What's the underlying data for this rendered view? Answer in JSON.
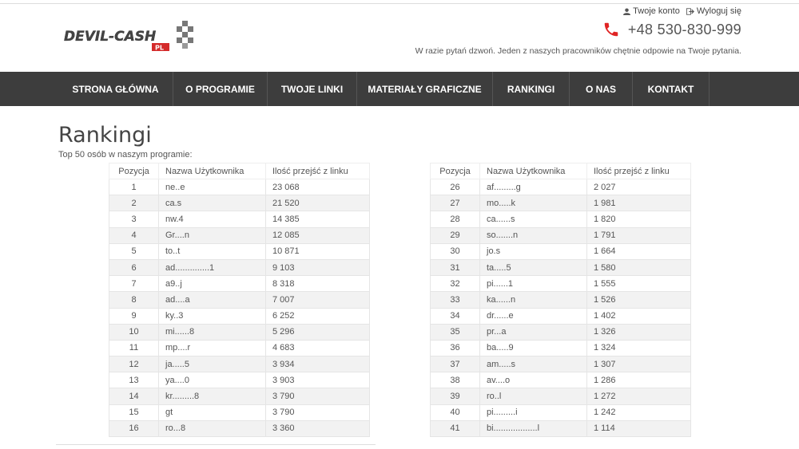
{
  "header": {
    "logo_text": "DEVIL-CASH",
    "logo_suffix": "PL",
    "account_label": "Twoje konto",
    "logout_label": "Wyloguj się",
    "phone": "+48 530-830-999",
    "tagline": "W razie pytań dzwoń. Jeden z naszych pracowników chętnie odpowie na Twoje pytania."
  },
  "nav": {
    "items": [
      {
        "label": "STRONA GŁÓWNA"
      },
      {
        "label": "O PROGRAMIE"
      },
      {
        "label": "TWOJE LINKI"
      },
      {
        "label": "MATERIAŁY GRAFICZNE"
      },
      {
        "label": "RANKINGI"
      },
      {
        "label": "O NAS"
      },
      {
        "label": "KONTAKT"
      }
    ]
  },
  "page": {
    "title": "Rankingi",
    "subtitle": "Top 50 osób w naszym programie:"
  },
  "table": {
    "headers": [
      "Pozycja",
      "Nazwa Użytkownika",
      "Ilość przejść z linku"
    ],
    "left_rows": [
      [
        "1",
        "ne..e",
        "23 068"
      ],
      [
        "2",
        "ca.s",
        "21 520"
      ],
      [
        "3",
        "nw.4",
        "14 385"
      ],
      [
        "4",
        "Gr....n",
        "12 085"
      ],
      [
        "5",
        "to..t",
        "10 871"
      ],
      [
        "6",
        "ad..............1",
        "9 103"
      ],
      [
        "7",
        "a9..j",
        "8 318"
      ],
      [
        "8",
        "ad....a",
        "7 007"
      ],
      [
        "9",
        "ky..3",
        "6 252"
      ],
      [
        "10",
        "mi......8",
        "5 296"
      ],
      [
        "11",
        "mp....r",
        "4 683"
      ],
      [
        "12",
        "ja.....5",
        "3 934"
      ],
      [
        "13",
        "ya....0",
        "3 903"
      ],
      [
        "14",
        "kr.........8",
        "3 790"
      ],
      [
        "15",
        "gt",
        "3 790"
      ],
      [
        "16",
        "ro...8",
        "3 360"
      ]
    ],
    "right_rows": [
      [
        "26",
        "af.........g",
        "2 027"
      ],
      [
        "27",
        "mo.....k",
        "1 981"
      ],
      [
        "28",
        "ca......s",
        "1 820"
      ],
      [
        "29",
        "so.......n",
        "1 791"
      ],
      [
        "30",
        "jo.s",
        "1 664"
      ],
      [
        "31",
        "ta.....5",
        "1 580"
      ],
      [
        "32",
        "pi......1",
        "1 555"
      ],
      [
        "33",
        "ka......n",
        "1 526"
      ],
      [
        "34",
        "dr......e",
        "1 402"
      ],
      [
        "35",
        "pr...a",
        "1 326"
      ],
      [
        "36",
        "ba.....9",
        "1 324"
      ],
      [
        "37",
        "am.....s",
        "1 307"
      ],
      [
        "38",
        "av....o",
        "1 286"
      ],
      [
        "39",
        "ro..l",
        "1 272"
      ],
      [
        "40",
        "pi.........i",
        "1 242"
      ],
      [
        "41",
        "bi..................l",
        "1 114"
      ]
    ]
  },
  "colors": {
    "nav_bg": "#3d3d3d",
    "accent_red": "#e02424",
    "logo_red": "#d42a2a"
  }
}
